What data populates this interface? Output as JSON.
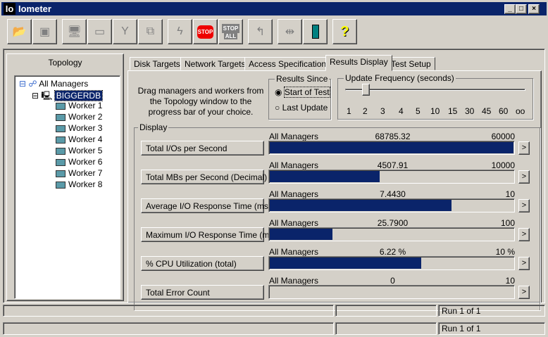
{
  "window": {
    "title": "Iometer",
    "logo": "Io"
  },
  "toolbar": {
    "buttons": [
      "open-icon",
      "save-icon",
      "new-manager-icon",
      "new-disk-worker-icon",
      "new-network-worker-icon",
      "duplicate-worker-icon",
      "start-icon",
      "stop-icon",
      "stop-all-icon",
      "reset-icon",
      "disconnect-icon",
      "exit-icon",
      "help-icon"
    ],
    "stop_label": "STOP",
    "stop_all_label": "STOP",
    "all_label": "ALL",
    "help_label": "?"
  },
  "topology": {
    "title": "Topology",
    "root": "All Managers",
    "manager": "BIGGERDB",
    "workers": [
      "Worker 1",
      "Worker 2",
      "Worker 3",
      "Worker 4",
      "Worker 5",
      "Worker 6",
      "Worker 7",
      "Worker 8"
    ]
  },
  "tabs": [
    "Disk Targets",
    "Network Targets",
    "Access Specifications",
    "Results Display",
    "Test Setup"
  ],
  "active_tab": "Results Display",
  "instructions": "Drag managers and workers from the Topology window to the progress bar of your choice.",
  "results_since": {
    "label": "Results Since",
    "options": [
      "Start of Test",
      "Last Update"
    ],
    "selected": "Start of Test"
  },
  "update_frequency": {
    "label": "Update Frequency (seconds)",
    "ticks": [
      "1",
      "2",
      "3",
      "4",
      "5",
      "10",
      "15",
      "30",
      "45",
      "60",
      "oo"
    ],
    "selected": "2"
  },
  "display": {
    "label": "Display",
    "rows": [
      {
        "metric": "Total I/Os per Second",
        "source": "All Managers",
        "value": "68785.32",
        "max": "60000",
        "fraction": 1.0
      },
      {
        "metric": "Total MBs per Second (Decimal)",
        "source": "All Managers",
        "value": "4507.91",
        "max": "10000",
        "fraction": 0.45
      },
      {
        "metric": "Average I/O Response Time (ms)",
        "source": "All Managers",
        "value": "7.4430",
        "max": "10",
        "fraction": 0.7444
      },
      {
        "metric": "Maximum I/O Response Time (ms)",
        "source": "All Managers",
        "value": "25.7900",
        "max": "100",
        "fraction": 0.2579
      },
      {
        "metric": "% CPU Utilization (total)",
        "source": "All Managers",
        "value": "6.22 %",
        "max": "10 %",
        "fraction": 0.622
      },
      {
        "metric": "Total Error Count",
        "source": "All Managers",
        "value": "0",
        "max": "10",
        "fraction": 0
      }
    ],
    "arrow": ">"
  },
  "status": [
    {
      "run": "Run 1 of 1"
    },
    {
      "run": "Run 1 of 1"
    }
  ]
}
